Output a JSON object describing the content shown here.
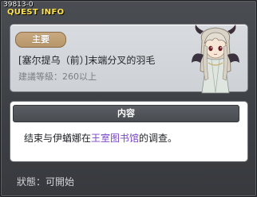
{
  "window": {
    "quest_id": "39813-0",
    "title": "QUEST INFO"
  },
  "quest": {
    "badge": "主要",
    "name": "[塞尔提乌（前）]末端分叉的羽毛",
    "level_requirement": "建議等級：260以上"
  },
  "content": {
    "header": "内容",
    "text_before": "结束与伊蝤娜在",
    "text_highlight": "王室图书馆",
    "text_after": "的调查。",
    "highlight_color": "#7a44c9"
  },
  "status": {
    "text": "狀態：可開始"
  },
  "colors": {
    "title": "#ffe24a",
    "badge": "#b6956a"
  }
}
